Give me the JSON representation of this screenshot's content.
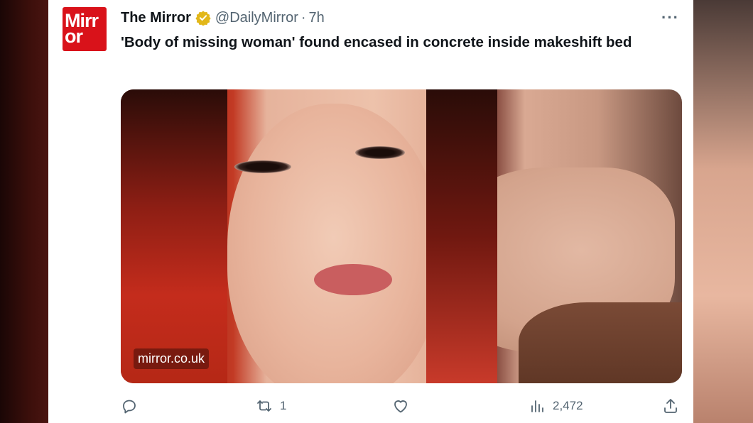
{
  "tweet": {
    "author_name": "The Mirror",
    "verified": true,
    "handle": "@DailyMirror",
    "separator": "·",
    "time": "7h",
    "more_label": "···",
    "text": "'Body of missing woman' found encased in concrete inside makeshift bed",
    "avatar": {
      "line1": "Mirr",
      "line2": "or",
      "color": "#d9121a"
    },
    "media": {
      "watermark": "mirror.co.uk"
    }
  },
  "actions": {
    "reply_count": "",
    "retweet_count": "1",
    "like_count": "",
    "views_count": "2,472",
    "share_count": ""
  },
  "icons": [
    "reply-icon",
    "retweet-icon",
    "like-icon",
    "views-icon",
    "share-icon",
    "verified-badge-icon",
    "more-icon"
  ],
  "colors": {
    "text": "#0f1419",
    "secondary": "#536471",
    "verified_gold": "#e2b719",
    "brand_red": "#d9121a"
  }
}
